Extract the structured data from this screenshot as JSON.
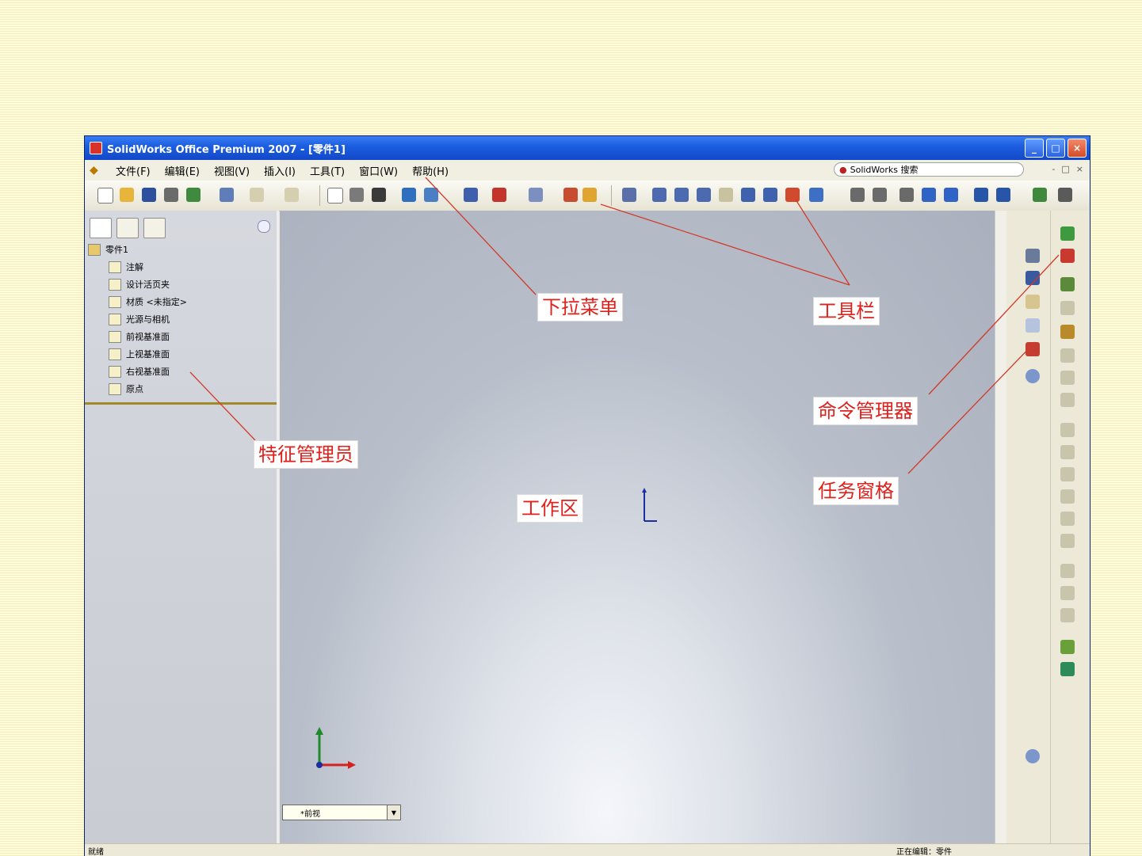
{
  "window": {
    "title": "SolidWorks Office Premium 2007 - [零件1]",
    "buttons": {
      "minimize": "_",
      "maximize": "□",
      "close": "×"
    }
  },
  "menubar": {
    "items": [
      "文件(F)",
      "编辑(E)",
      "视图(V)",
      "插入(I)",
      "工具(T)",
      "窗口(W)",
      "帮助(H)"
    ],
    "search_placeholder": "SolidWorks 搜索",
    "doc_buttons": [
      "-",
      "□",
      "×"
    ]
  },
  "feature_tree": {
    "root": "零件1",
    "items": [
      "注解",
      "设计活页夹",
      "材质 <未指定>",
      "光源与相机",
      "前视基准面",
      "上视基准面",
      "右视基准面",
      "原点"
    ]
  },
  "graphics": {
    "view_select_value": "*前视"
  },
  "statusbar": {
    "left": "就绪",
    "right": "正在编辑：零件"
  },
  "annotations": {
    "dropdown_menu": "下拉菜单",
    "toolbar": "工具栏",
    "command_manager": "命令管理器",
    "task_pane": "任务窗格",
    "feature_manager": "特征管理员",
    "work_area": "工作区"
  },
  "colors": {
    "annotation_text": "#e0201a",
    "leader_line": "#d23a2a",
    "titlebar": "#1c5fe0"
  }
}
